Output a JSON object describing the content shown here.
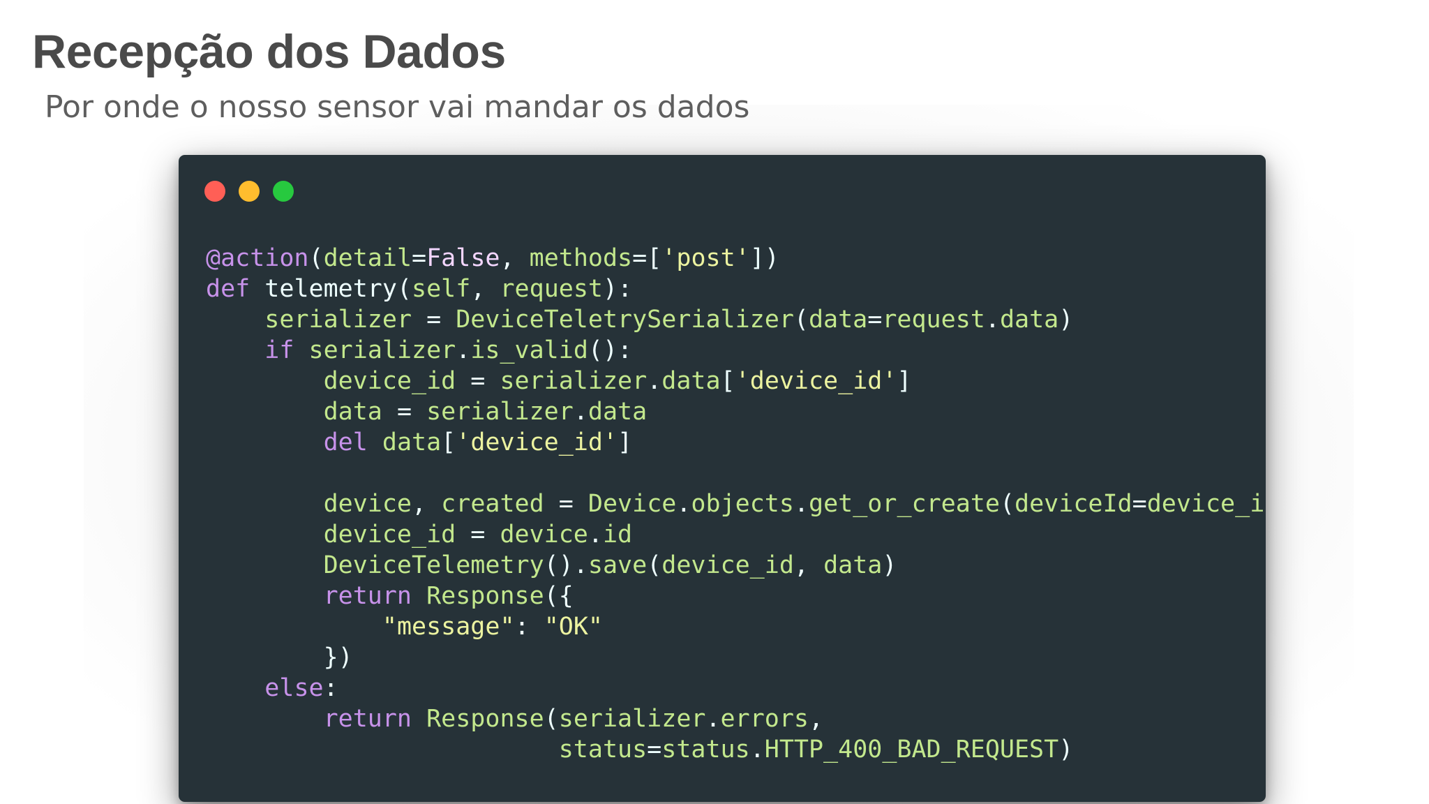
{
  "slide": {
    "title": "Recepção dos Dados",
    "subtitle": "Por onde o nosso sensor vai mandar os dados"
  },
  "window": {
    "dots": [
      {
        "name": "close-dot",
        "color": "#ff5f56"
      },
      {
        "name": "minimize-dot",
        "color": "#ffbd2e"
      },
      {
        "name": "maximize-dot",
        "color": "#27c93f"
      }
    ]
  },
  "code": {
    "language": "python",
    "lines": [
      [
        [
          "dec",
          "@action"
        ],
        [
          "punc",
          "("
        ],
        [
          "attr",
          "detail"
        ],
        [
          "punc",
          "="
        ],
        [
          "bool",
          "False"
        ],
        [
          "punc",
          ", "
        ],
        [
          "attr",
          "methods"
        ],
        [
          "punc",
          "=["
        ],
        [
          "str",
          "'post'"
        ],
        [
          "punc",
          "])"
        ]
      ],
      [
        [
          "kw",
          "def"
        ],
        [
          "space",
          " "
        ],
        [
          "fn",
          "telemetry"
        ],
        [
          "punc",
          "("
        ],
        [
          "var",
          "self"
        ],
        [
          "punc",
          ", "
        ],
        [
          "var",
          "request"
        ],
        [
          "punc",
          "):"
        ]
      ],
      [
        [
          "space",
          "    "
        ],
        [
          "var",
          "serializer"
        ],
        [
          "punc",
          " = "
        ],
        [
          "class",
          "DeviceTeletrySerializer"
        ],
        [
          "punc",
          "("
        ],
        [
          "attr",
          "data"
        ],
        [
          "punc",
          "="
        ],
        [
          "var",
          "request"
        ],
        [
          "punc",
          "."
        ],
        [
          "meth",
          "data"
        ],
        [
          "punc",
          ")"
        ]
      ],
      [
        [
          "space",
          "    "
        ],
        [
          "kw",
          "if"
        ],
        [
          "space",
          " "
        ],
        [
          "var",
          "serializer"
        ],
        [
          "punc",
          "."
        ],
        [
          "meth",
          "is_valid"
        ],
        [
          "punc",
          "():"
        ]
      ],
      [
        [
          "space",
          "        "
        ],
        [
          "var",
          "device_id"
        ],
        [
          "punc",
          " = "
        ],
        [
          "var",
          "serializer"
        ],
        [
          "punc",
          "."
        ],
        [
          "meth",
          "data"
        ],
        [
          "punc",
          "["
        ],
        [
          "str",
          "'device_id'"
        ],
        [
          "punc",
          "]"
        ]
      ],
      [
        [
          "space",
          "        "
        ],
        [
          "var",
          "data"
        ],
        [
          "punc",
          " = "
        ],
        [
          "var",
          "serializer"
        ],
        [
          "punc",
          "."
        ],
        [
          "meth",
          "data"
        ]
      ],
      [
        [
          "space",
          "        "
        ],
        [
          "kw",
          "del"
        ],
        [
          "space",
          " "
        ],
        [
          "var",
          "data"
        ],
        [
          "punc",
          "["
        ],
        [
          "str",
          "'device_id'"
        ],
        [
          "punc",
          "]"
        ]
      ],
      [],
      [
        [
          "space",
          "        "
        ],
        [
          "var",
          "device"
        ],
        [
          "punc",
          ", "
        ],
        [
          "var",
          "created"
        ],
        [
          "punc",
          " = "
        ],
        [
          "class",
          "Device"
        ],
        [
          "punc",
          "."
        ],
        [
          "meth",
          "objects"
        ],
        [
          "punc",
          "."
        ],
        [
          "meth",
          "get_or_create"
        ],
        [
          "punc",
          "("
        ],
        [
          "attr",
          "deviceId"
        ],
        [
          "punc",
          "="
        ],
        [
          "var",
          "device_id"
        ],
        [
          "punc",
          ",)"
        ]
      ],
      [
        [
          "space",
          "        "
        ],
        [
          "var",
          "device_id"
        ],
        [
          "punc",
          " = "
        ],
        [
          "var",
          "device"
        ],
        [
          "punc",
          "."
        ],
        [
          "meth",
          "id"
        ]
      ],
      [
        [
          "space",
          "        "
        ],
        [
          "class",
          "DeviceTelemetry"
        ],
        [
          "punc",
          "()."
        ],
        [
          "meth",
          "save"
        ],
        [
          "punc",
          "("
        ],
        [
          "var",
          "device_id"
        ],
        [
          "punc",
          ", "
        ],
        [
          "var",
          "data"
        ],
        [
          "punc",
          ")"
        ]
      ],
      [
        [
          "space",
          "        "
        ],
        [
          "kw",
          "return"
        ],
        [
          "space",
          " "
        ],
        [
          "class",
          "Response"
        ],
        [
          "punc",
          "({"
        ]
      ],
      [
        [
          "space",
          "            "
        ],
        [
          "str",
          "\"message\""
        ],
        [
          "punc",
          ": "
        ],
        [
          "str",
          "\"OK\""
        ]
      ],
      [
        [
          "space",
          "        "
        ],
        [
          "punc",
          "})"
        ]
      ],
      [
        [
          "space",
          "    "
        ],
        [
          "kw",
          "else"
        ],
        [
          "punc",
          ":"
        ]
      ],
      [
        [
          "space",
          "        "
        ],
        [
          "kw",
          "return"
        ],
        [
          "space",
          " "
        ],
        [
          "class",
          "Response"
        ],
        [
          "punc",
          "("
        ],
        [
          "var",
          "serializer"
        ],
        [
          "punc",
          "."
        ],
        [
          "meth",
          "errors"
        ],
        [
          "punc",
          ","
        ]
      ],
      [
        [
          "space",
          "                        "
        ],
        [
          "attr",
          "status"
        ],
        [
          "punc",
          "="
        ],
        [
          "var",
          "status"
        ],
        [
          "punc",
          "."
        ],
        [
          "meth",
          "HTTP_400_BAD_REQUEST"
        ],
        [
          "punc",
          ")"
        ]
      ]
    ]
  }
}
